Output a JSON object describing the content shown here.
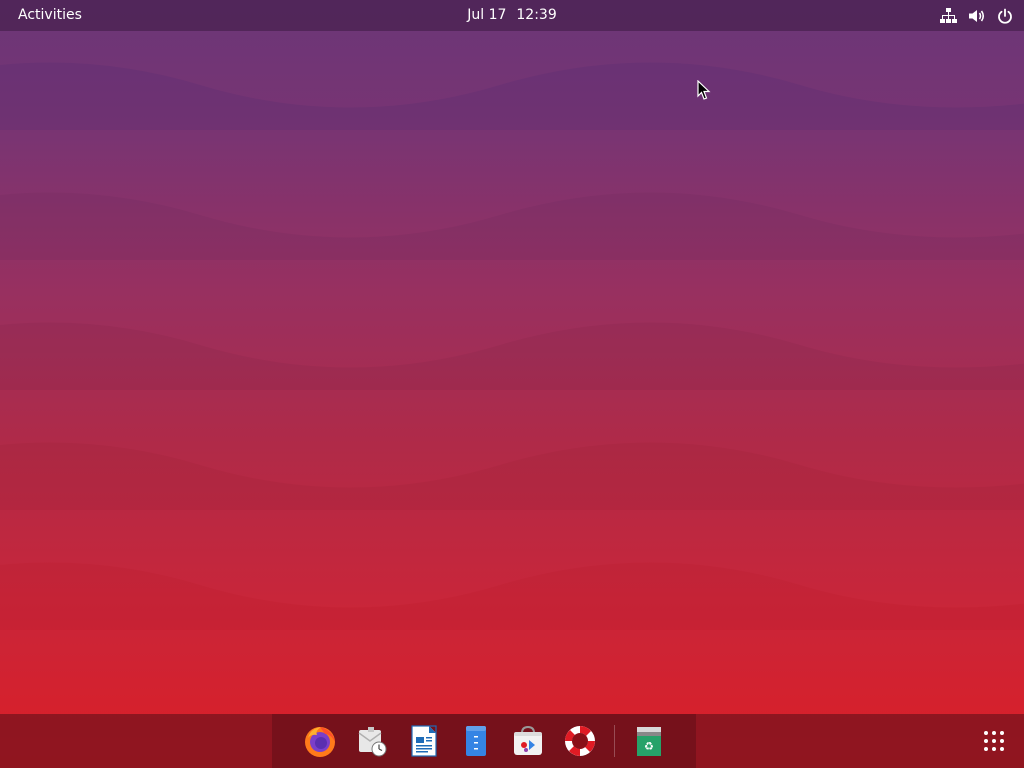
{
  "topbar": {
    "activities_label": "Activities",
    "date": "Jul 17",
    "time": "12:39",
    "tray_icons": [
      "network-icon",
      "volume-icon",
      "power-icon"
    ]
  },
  "dock": {
    "apps": [
      {
        "name": "firefox-icon"
      },
      {
        "name": "mail-clock-icon"
      },
      {
        "name": "libreoffice-writer-icon"
      },
      {
        "name": "text-editor-icon"
      },
      {
        "name": "software-store-icon"
      },
      {
        "name": "help-lifebuoy-icon"
      },
      {
        "name": "trash-recycle-icon"
      }
    ],
    "show_apps_icon": "apps-grid-icon"
  },
  "colors": {
    "topbar": "#4a2050",
    "wallpaper_top": "#6a3678",
    "wallpaper_bottom": "#dc1e26",
    "dock": "#7a1420"
  }
}
